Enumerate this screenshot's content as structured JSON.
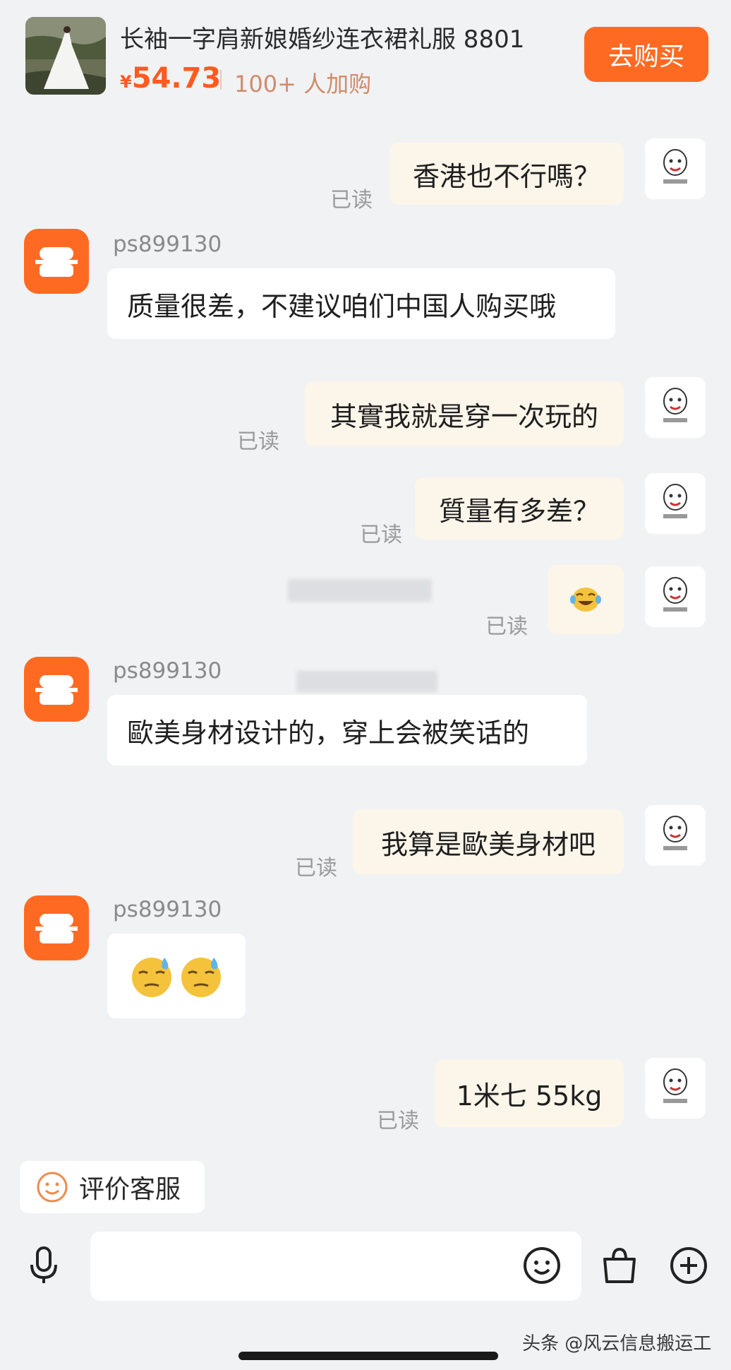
{
  "product": {
    "title": "长袖一字肩新娘婚纱连衣裙礼服 8801",
    "currency": "¥",
    "price": "54.73",
    "added": "100+ 人加购",
    "buy_label": "去购买"
  },
  "shop_name": "ps899130",
  "read_label": "已读",
  "messages": {
    "m1": "香港也不行嗎？",
    "m2": "质量很差，不建议咱们中国人购买哦",
    "m3": "其實我就是穿一次玩的",
    "m4": "質量有多差？",
    "m6": "歐美身材设计的，穿上会被笑话的",
    "m7": "我算是歐美身材吧",
    "m9": "1米七 55kg"
  },
  "rate_label": "评价客服",
  "watermark": "头条 @风云信息搬运工",
  "colors": {
    "accent": "#ff6a22",
    "price": "#ff5a1f",
    "my_bubble": "#fbf5ea"
  }
}
